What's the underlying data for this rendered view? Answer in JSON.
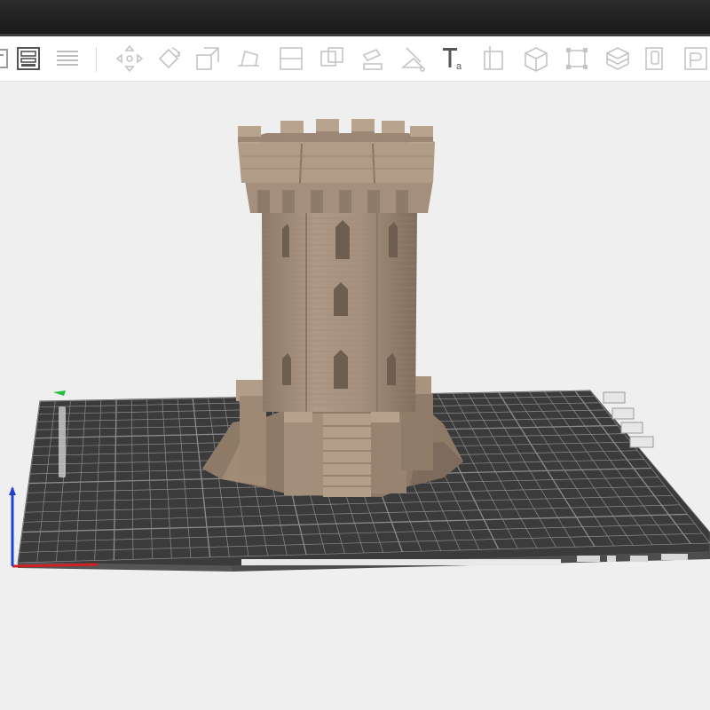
{
  "window": {
    "title": ""
  },
  "toolbar": {
    "tools": [
      {
        "icon": "list-icon"
      },
      {
        "icon": "object-list-icon"
      },
      {
        "icon": "layers-icon"
      },
      {
        "icon": "move-icon"
      },
      {
        "icon": "rotate-icon"
      },
      {
        "icon": "scale-icon"
      },
      {
        "icon": "lay-on-face-icon"
      },
      {
        "icon": "split-icon"
      },
      {
        "icon": "arrange-icon"
      },
      {
        "icon": "paint-icon"
      },
      {
        "icon": "seam-painting-icon"
      },
      {
        "icon": "text-icon"
      },
      {
        "icon": "cut-icon"
      },
      {
        "icon": "cube-icon"
      },
      {
        "icon": "fit-icon"
      },
      {
        "icon": "stack-icon"
      },
      {
        "icon": "copy-icon"
      },
      {
        "icon": "preview-icon"
      }
    ]
  },
  "viewport": {
    "model_color": "#a89480",
    "bed_color": "#3b3b3b",
    "grid_color": "#8c8c8c",
    "background_color": "#efefef"
  },
  "axes": {
    "x_color": "#d42020",
    "z_color": "#2040d0",
    "y_color": "#20c040"
  }
}
